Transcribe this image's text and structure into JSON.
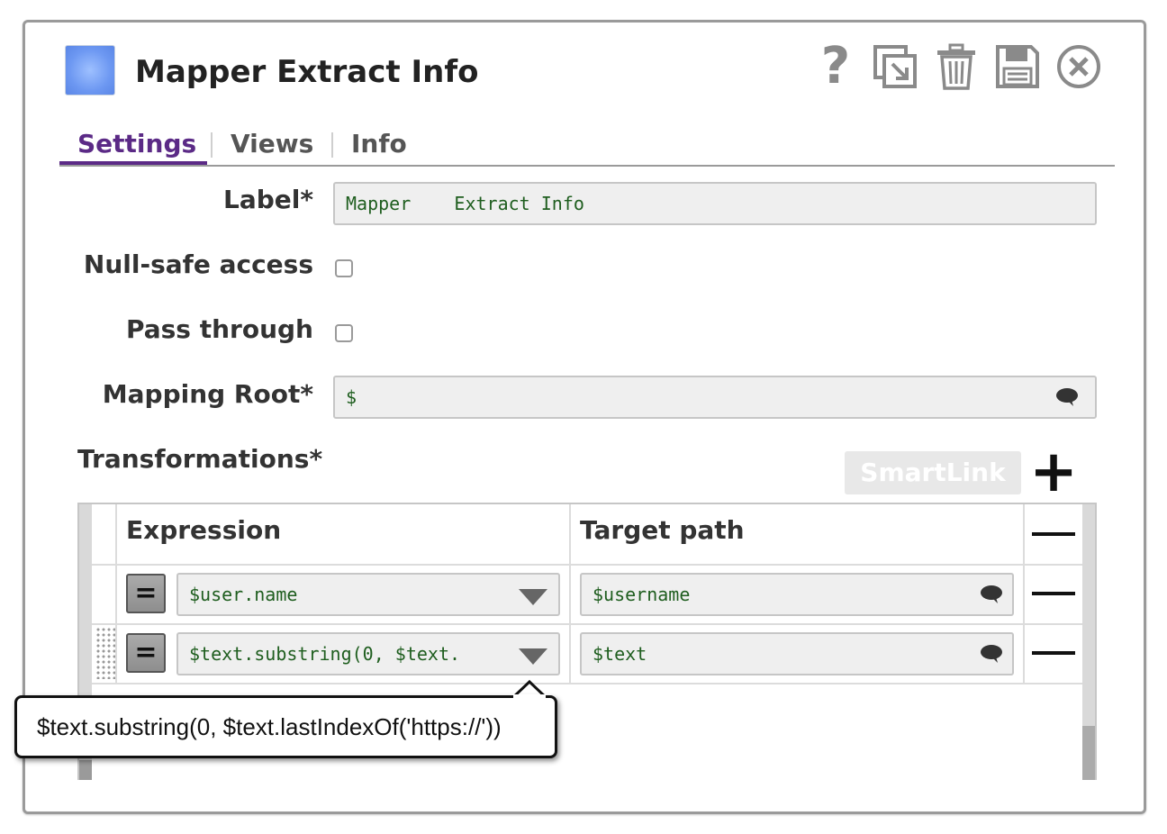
{
  "header": {
    "title": "Mapper Extract Info",
    "icons": [
      "help-icon",
      "export-icon",
      "trash-icon",
      "save-icon",
      "close-icon"
    ],
    "help_glyph": "?"
  },
  "tabs": [
    {
      "label": "Settings",
      "active": true
    },
    {
      "label": "Views",
      "active": false
    },
    {
      "label": "Info",
      "active": false
    }
  ],
  "form": {
    "label_label": "Label*",
    "label_value": "Mapper    Extract Info",
    "null_safe_label": "Null-safe access",
    "null_safe_checked": false,
    "pass_through_label": "Pass through",
    "pass_through_checked": false,
    "mapping_root_label": "Mapping Root*",
    "mapping_root_value": "$"
  },
  "transformations": {
    "label": "Transformations*",
    "smartlink_label": "SmartLink",
    "add_glyph": "+",
    "columns": [
      "Expression",
      "Target path"
    ],
    "eq_glyph": "=",
    "rows": [
      {
        "expression": "$user.name",
        "target": "$username"
      },
      {
        "expression": "$text.substring(0, $text.",
        "target": "$text"
      }
    ]
  },
  "tooltip": {
    "text": "$text.substring(0, $text.lastIndexOf('https://'))"
  },
  "colors": {
    "accent": "#5b2a86",
    "field_text": "#1f5e1f",
    "field_bg": "#efefef"
  }
}
